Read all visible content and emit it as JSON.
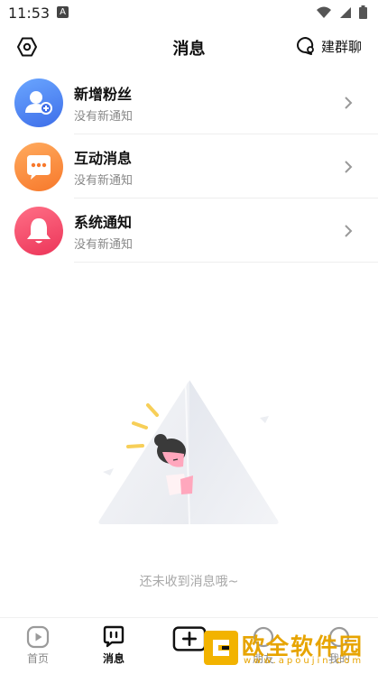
{
  "status_bar": {
    "time": "11:53",
    "indicator": "A"
  },
  "header": {
    "title": "消息",
    "group_chat_label": "建群聊"
  },
  "messages": [
    {
      "title": "新增粉丝",
      "subtitle": "没有新通知",
      "color": "#4a7cf3",
      "icon": "user-add-icon"
    },
    {
      "title": "互动消息",
      "subtitle": "没有新通知",
      "color": "#fb8a3c",
      "icon": "chat-bubble-icon"
    },
    {
      "title": "系统通知",
      "subtitle": "没有新通知",
      "color": "#f2496a",
      "icon": "bell-icon"
    }
  ],
  "empty_state": {
    "text": "还未收到消息哦~"
  },
  "bottom_nav": {
    "tabs": [
      {
        "label": "首页",
        "icon": "play-icon",
        "active": false
      },
      {
        "label": "消息",
        "icon": "message-icon",
        "active": true
      },
      {
        "label": "",
        "icon": "plus-icon",
        "active": false
      },
      {
        "label": "朋友",
        "icon": "friends-icon",
        "active": false
      },
      {
        "label": "我的",
        "icon": "profile-icon",
        "active": false
      }
    ]
  },
  "watermark": {
    "text": "欧全软件园",
    "url": "www.apoujin.com"
  }
}
